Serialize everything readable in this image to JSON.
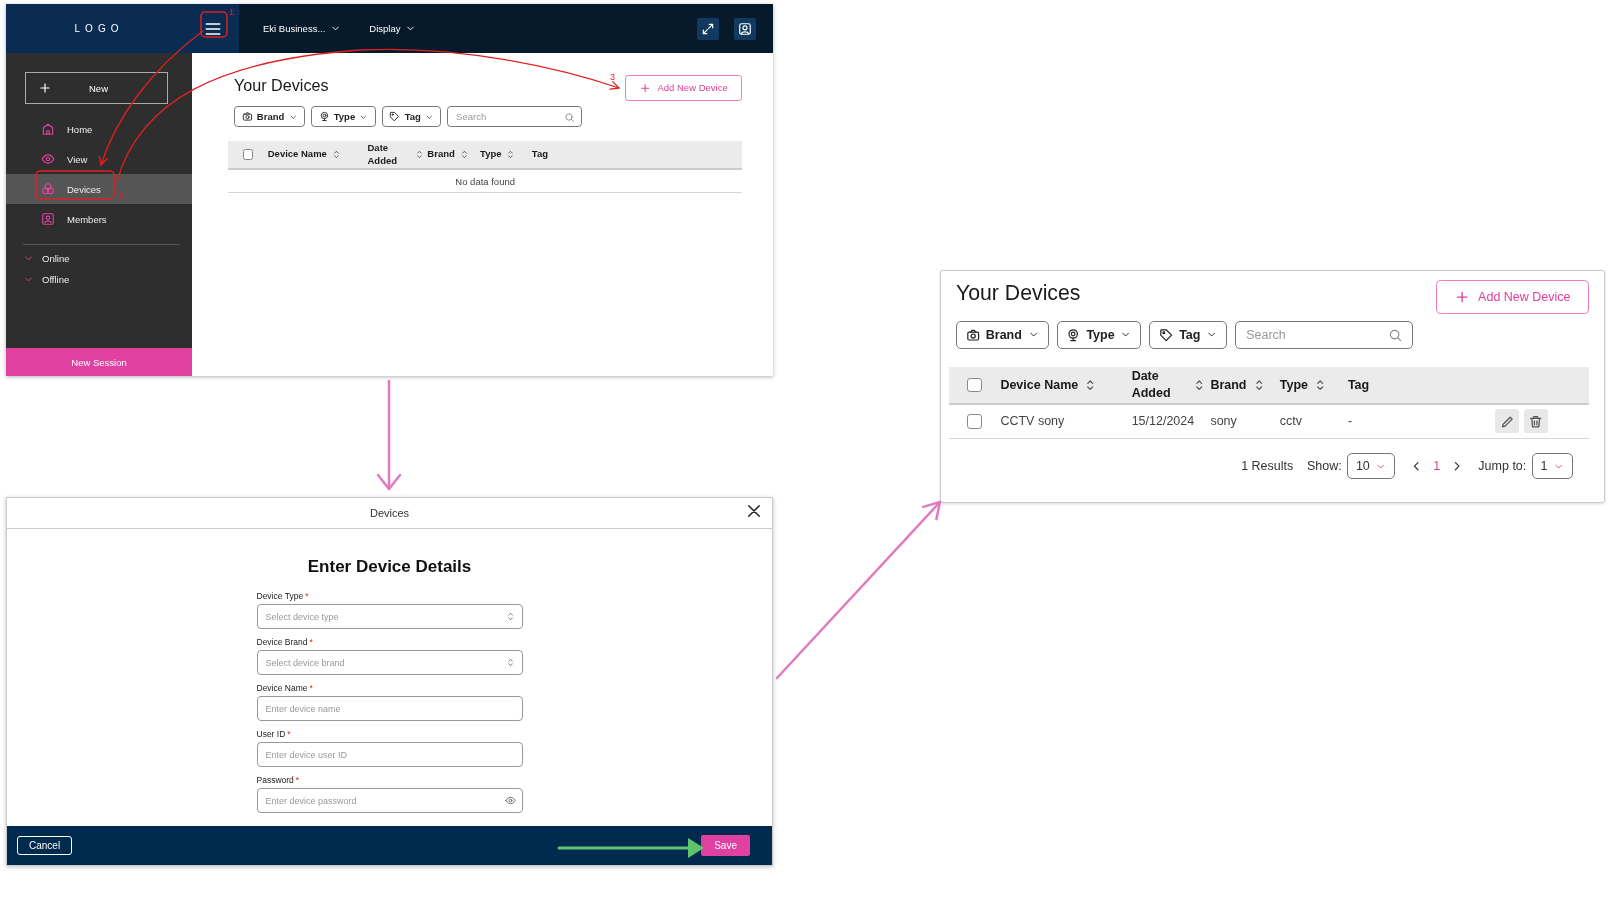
{
  "overview_screen": {
    "header": {
      "logo": "LOGO",
      "menus": [
        {
          "label": "Eki Business..."
        },
        {
          "label": "Display"
        }
      ]
    },
    "sidebar": {
      "new_button": "New",
      "items": [
        {
          "label": "Home",
          "selected": false
        },
        {
          "label": "View",
          "selected": false
        },
        {
          "label": "Devices",
          "selected": true
        },
        {
          "label": "Members",
          "selected": false
        }
      ],
      "groups": [
        {
          "label": "Online",
          "expanded": true
        },
        {
          "label": "Offline",
          "expanded": true
        }
      ],
      "footer_button": "New Session"
    },
    "page": {
      "title": "Your Devices",
      "add_button": "Add New Device",
      "filters": [
        {
          "label": "Brand"
        },
        {
          "label": "Type"
        },
        {
          "label": "Tag"
        }
      ],
      "search": {
        "placeholder": "Search"
      },
      "table": {
        "select_all_checked": false,
        "columns": [
          {
            "label": "Device Name",
            "sortable": true
          },
          {
            "label": "Date Added",
            "sortable": true
          },
          {
            "label": "Brand",
            "sortable": true
          },
          {
            "label": "Type",
            "sortable": true
          },
          {
            "label": "Tag",
            "sortable": false
          }
        ],
        "empty_text": "No data found"
      }
    }
  },
  "annotations": [
    {
      "number": "1"
    },
    {
      "number": "2"
    },
    {
      "number": "3"
    }
  ],
  "modal": {
    "title": "Devices",
    "heading": "Enter Device Details",
    "fields": [
      {
        "kind": "select",
        "label": "Device Type",
        "required_mark": "*",
        "placeholder": "Select device type"
      },
      {
        "kind": "select",
        "label": "Device Brand",
        "required_mark": "*",
        "placeholder": "Select device brand"
      },
      {
        "kind": "text",
        "label": "Device Name",
        "required_mark": "*",
        "placeholder": "Enter device name"
      },
      {
        "kind": "text",
        "label": "User ID",
        "required_mark": "*",
        "placeholder": "Enter device user ID"
      },
      {
        "kind": "password",
        "label": "Password",
        "required_mark": "*",
        "placeholder": "Enter device password"
      }
    ],
    "cancel_button": "Cancel",
    "save_button": "Save"
  },
  "result_screen": {
    "title": "Your Devices",
    "add_button": "Add New Device",
    "filters": [
      {
        "label": "Brand"
      },
      {
        "label": "Type"
      },
      {
        "label": "Tag"
      }
    ],
    "search": {
      "placeholder": "Search"
    },
    "table": {
      "select_all_checked": false,
      "columns": [
        {
          "label": "Device Name",
          "sortable": true
        },
        {
          "label": "Date Added",
          "sortable": true
        },
        {
          "label": "Brand",
          "sortable": true
        },
        {
          "label": "Type",
          "sortable": true
        },
        {
          "label": "Tag",
          "sortable": false
        }
      ],
      "rows": [
        {
          "checked": false,
          "cells": [
            "CCTV sony",
            "15/12/2024",
            "sony",
            "cctv",
            "-"
          ]
        }
      ]
    },
    "pagination": {
      "results": "1 Results",
      "show_label": "Show:",
      "page_size": "10",
      "pages": [
        {
          "label": "1",
          "selected": true
        }
      ],
      "jump_label": "Jump to:",
      "jump_value": "1"
    }
  }
}
